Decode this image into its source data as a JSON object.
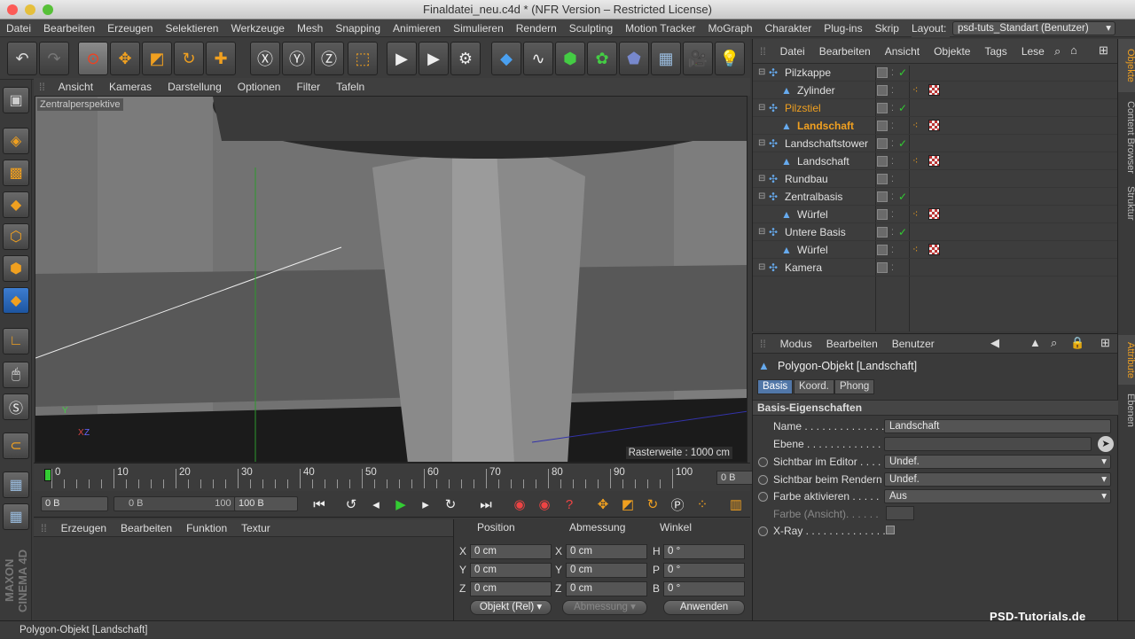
{
  "window": {
    "title": "Finaldatei_neu.c4d * (NFR Version – Restricted License)"
  },
  "menubar": {
    "items": [
      "Datei",
      "Bearbeiten",
      "Erzeugen",
      "Selektieren",
      "Werkzeuge",
      "Mesh",
      "Snapping",
      "Animieren",
      "Simulieren",
      "Rendern",
      "Sculpting",
      "Motion Tracker",
      "MoGraph",
      "Charakter",
      "Plug-ins",
      "Skrip"
    ],
    "layout_label": "Layout:",
    "layout_value": "psd-tuts_Standart (Benutzer)"
  },
  "viewport": {
    "menu": [
      "Ansicht",
      "Kameras",
      "Darstellung",
      "Optionen",
      "Filter",
      "Tafeln"
    ],
    "label": "Zentralperspektive",
    "raster": "Rasterweite : 1000 cm"
  },
  "timeline": {
    "ticks": [
      "0",
      "10",
      "20",
      "30",
      "40",
      "50",
      "60",
      "70",
      "80",
      "90",
      "100"
    ],
    "current": "0 B",
    "start": "0 B",
    "range_start": "0 B",
    "range_end": "100 B",
    "end": "100 B"
  },
  "materials": {
    "menu": [
      "Erzeugen",
      "Bearbeiten",
      "Funktion",
      "Textur"
    ]
  },
  "coords": {
    "headers": [
      "Position",
      "Abmessung",
      "Winkel"
    ],
    "rows": [
      {
        "a": "X",
        "p": "0 cm",
        "b": "X",
        "s": "0 cm",
        "c": "H",
        "r": "0 °"
      },
      {
        "a": "Y",
        "p": "0 cm",
        "b": "Y",
        "s": "0 cm",
        "c": "P",
        "r": "0 °"
      },
      {
        "a": "Z",
        "p": "0 cm",
        "b": "Z",
        "s": "0 cm",
        "c": "B",
        "r": "0 °"
      }
    ],
    "mode": "Objekt (Rel)",
    "mode2": "Abmessung",
    "apply": "Anwenden"
  },
  "objects": {
    "menu": [
      "Datei",
      "Bearbeiten",
      "Ansicht",
      "Objekte",
      "Tags",
      "Lese"
    ],
    "rows": [
      {
        "name": "Pilzkappe",
        "indent": 0,
        "check": true,
        "mat": false,
        "sel": false
      },
      {
        "name": "Zylinder",
        "indent": 1,
        "check": false,
        "mat": true,
        "sel": false
      },
      {
        "name": "Pilzstiel",
        "indent": 0,
        "check": true,
        "mat": false,
        "sel": true
      },
      {
        "name": "Landschaft",
        "indent": 1,
        "check": false,
        "mat": true,
        "sel": true
      },
      {
        "name": "Landschaftstower",
        "indent": 0,
        "check": true,
        "mat": false,
        "sel": false
      },
      {
        "name": "Landschaft",
        "indent": 1,
        "check": false,
        "mat": true,
        "sel": false
      },
      {
        "name": "Rundbau",
        "indent": 0,
        "check": false,
        "mat": false,
        "sel": false
      },
      {
        "name": "Zentralbasis",
        "indent": 0,
        "check": true,
        "mat": false,
        "sel": false
      },
      {
        "name": "Würfel",
        "indent": 1,
        "check": false,
        "mat": true,
        "sel": false
      },
      {
        "name": "Untere Basis",
        "indent": 0,
        "check": true,
        "mat": false,
        "sel": false
      },
      {
        "name": "Würfel",
        "indent": 1,
        "check": false,
        "mat": true,
        "sel": false
      },
      {
        "name": "Kamera",
        "indent": 0,
        "check": false,
        "mat": false,
        "sel": false
      }
    ]
  },
  "sidetabs": [
    "Objekte",
    "Content Browser",
    "Struktur",
    "Attribute",
    "Ebenen"
  ],
  "attributes": {
    "menu": [
      "Modus",
      "Bearbeiten",
      "Benutzer"
    ],
    "object": "Polygon-Objekt [Landschaft]",
    "tabs": [
      "Basis",
      "Koord.",
      "Phong"
    ],
    "section": "Basis-Eigenschaften",
    "name_label": "Name . . . . . . . . . . . . . . .",
    "name_value": "Landschaft",
    "layer_label": "Ebene . . . . . . . . . . . . . . .",
    "editor_label": "Sichtbar im Editor . . . .",
    "editor_value": "Undef.",
    "render_label": "Sichtbar beim Rendern",
    "render_value": "Undef.",
    "color_label": "Farbe aktivieren . . . . .",
    "color_value": "Aus",
    "viewcolor_label": "Farbe (Ansicht). . . . . .",
    "xray_label": "X-Ray . . . . . . . . . . . . . ."
  },
  "status": "Polygon-Objekt [Landschaft]",
  "watermark": "PSD-Tutorials.de",
  "colors": {
    "accent": "#f0a020",
    "selected": "#f0a020",
    "check": "#33cc33"
  }
}
